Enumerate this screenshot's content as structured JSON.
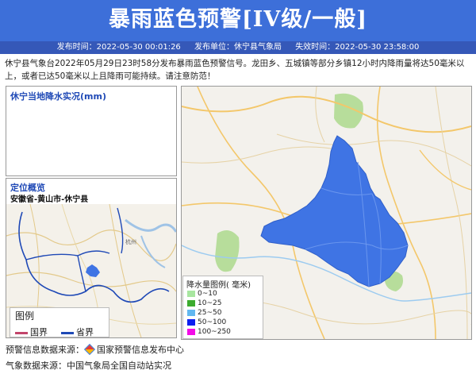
{
  "header": {
    "title": "暴雨蓝色预警[IV级/一般]",
    "publish_time": "发布时间：2022-05-30 00:01:26",
    "publisher": "发布单位：休宁县气象局",
    "expire_time": "失效时间：2022-05-30 23:58:00"
  },
  "description": "休宁县气象台2022年05月29日23时58分发布暴雨蓝色预警信号。龙田乡、五城镇等部分乡镇12小时内降雨量将达50毫米以上，或者已达50毫米以上且降雨可能持续。请注意防范！",
  "rain_panel": {
    "title": "休宁当地降水实况(mm)"
  },
  "location_panel": {
    "title": "定位概览",
    "region": "安徽省-黄山市-休宁县",
    "legend": {
      "title": "图例",
      "items": [
        {
          "label": "国界",
          "color": "#c2456b"
        },
        {
          "label": "省界",
          "color": "#1f49b6"
        }
      ]
    }
  },
  "rain_legend": {
    "title": "降水量图例( 毫米)",
    "items": [
      {
        "label": "0~10",
        "color": "#a8e6a0"
      },
      {
        "label": "10~25",
        "color": "#3cab2e"
      },
      {
        "label": "25~50",
        "color": "#62b8f0"
      },
      {
        "label": "50~100",
        "color": "#0b1ef0"
      },
      {
        "label": "100~250",
        "color": "#f20ce6"
      }
    ]
  },
  "footer": {
    "warning_source_label": "预警信息数据来源：",
    "warning_source_name": "国家预警信息发布中心",
    "weather_source": "气象数据来源：中国气象局全国自动站实况"
  },
  "colors": {
    "banner": "#3d6fd9",
    "infobar": "#3558b8",
    "warning_area": "#3f74e4"
  }
}
